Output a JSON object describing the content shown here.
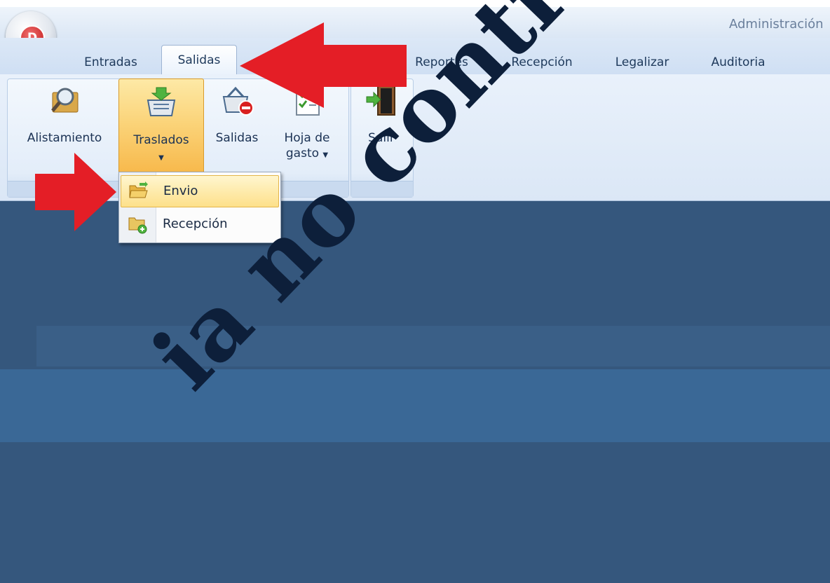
{
  "window": {
    "title": "Administración"
  },
  "app_button": {
    "letter": "D",
    "icon": "app-logo-icon"
  },
  "tabs": [
    {
      "label": "Entradas",
      "active": false
    },
    {
      "label": "Salidas",
      "active": true
    },
    {
      "label": "Reportes",
      "active": false
    },
    {
      "label": "Recepción",
      "active": false
    },
    {
      "label": "Legalizar",
      "active": false
    },
    {
      "label": "Auditoria",
      "active": false
    }
  ],
  "ribbon": {
    "buttons": [
      {
        "label": "Alistamiento",
        "icon": "search-document-icon"
      },
      {
        "label": "Traslados",
        "icon": "basket-arrow-icon",
        "has_dropdown": true,
        "highlighted": true
      },
      {
        "label": "Salidas",
        "icon": "basket-remove-icon"
      },
      {
        "label": "Hoja de",
        "label2": "gasto",
        "icon": "checklist-icon",
        "has_dropdown": true
      },
      {
        "label": "Salir",
        "icon": "exit-door-icon"
      }
    ]
  },
  "dropdown": {
    "items": [
      {
        "label": "Envio",
        "icon": "open-folder-icon",
        "highlighted": true
      },
      {
        "label": "Recepción",
        "icon": "folder-add-icon"
      }
    ]
  },
  "watermark": {
    "text": "ia no controlada"
  },
  "colors": {
    "accent_red": "#e41e26",
    "content_bg": "#35577d",
    "highlight": "#fbd47a"
  }
}
